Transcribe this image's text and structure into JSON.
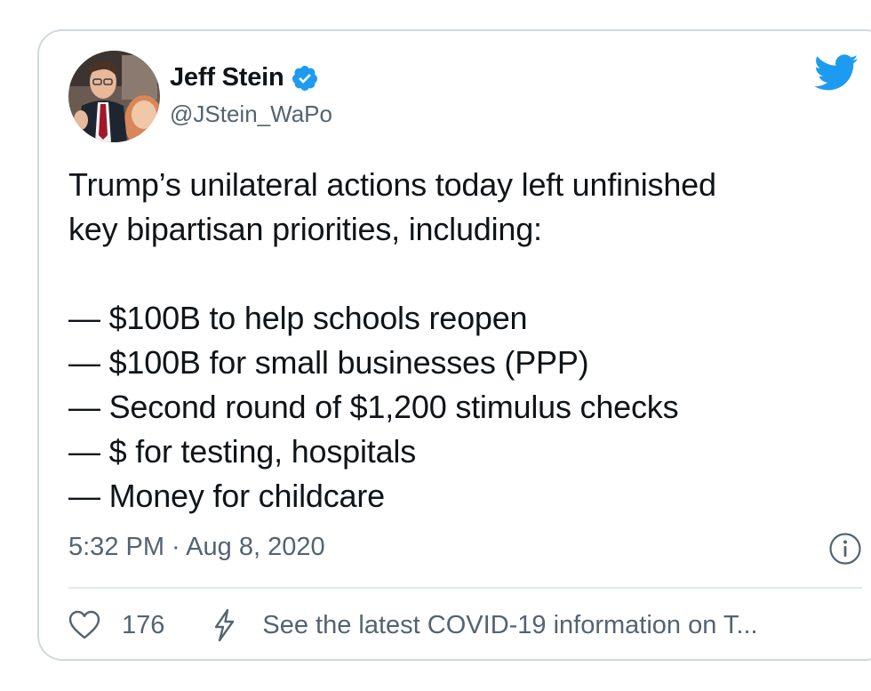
{
  "author": {
    "display_name": "Jeff Stein",
    "handle": "@JStein_WaPo",
    "verified": true
  },
  "tweet": {
    "lines": [
      "Trump’s unilateral actions today left unfinished",
      "key bipartisan priorities, including:",
      "",
      "— $100B to help schools reopen",
      "— $100B for small businesses (PPP)",
      "— Second round of $1,200 stimulus checks",
      "— $ for testing, hospitals",
      "— Money for childcare"
    ]
  },
  "meta": {
    "timestamp": "5:32 PM · Aug 8, 2020"
  },
  "actions": {
    "like_count": "176",
    "covid_link": "See the latest COVID-19 information on T..."
  },
  "icons": {
    "brand": "twitter-bird-icon",
    "verified": "verified-badge-icon",
    "info": "info-icon",
    "like": "heart-icon",
    "covid": "lightning-bolt-icon"
  },
  "colors": {
    "brand_blue": "#1d9bf0",
    "text_primary": "#0f1419",
    "text_secondary": "#536471",
    "border": "#cfd9de"
  }
}
